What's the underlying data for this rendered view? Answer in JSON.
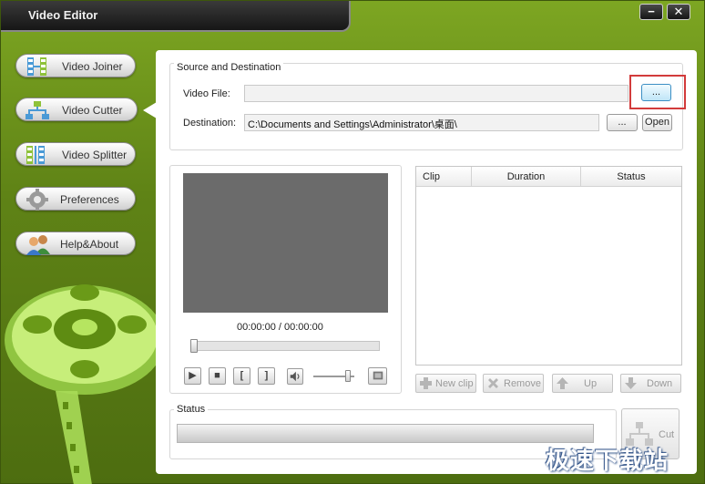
{
  "window": {
    "title": "Video Editor",
    "minimize_label": "−",
    "close_label": "✕"
  },
  "sidebar": {
    "items": [
      {
        "label": "Video Joiner",
        "icon": "video-joiner-icon"
      },
      {
        "label": "Video Cutter",
        "icon": "video-cutter-icon",
        "active": true
      },
      {
        "label": "Video Splitter",
        "icon": "video-splitter-icon"
      },
      {
        "label": "Preferences",
        "icon": "gear-icon"
      },
      {
        "label": "Help&About",
        "icon": "users-icon"
      }
    ]
  },
  "source": {
    "group_title": "Source and Destination",
    "video_file_label": "Video File:",
    "video_file_value": "",
    "browse_label": "...",
    "destination_label": "Destination:",
    "destination_value": "C:\\Documents and Settings\\Administrator\\桌面\\",
    "dest_browse_label": "...",
    "open_label": "Open"
  },
  "player": {
    "time": "00:00:00 / 00:00:00",
    "progress": 0,
    "volume": 0.9,
    "play_icon": "▶",
    "stop_icon": "■",
    "mark_in_icon": "[",
    "mark_out_icon": "]"
  },
  "clips": {
    "columns": [
      "Clip",
      "Duration",
      "Status"
    ],
    "rows": [],
    "new_clip_label": "New clip",
    "remove_label": "Remove",
    "up_label": "Up",
    "down_label": "Down"
  },
  "status": {
    "group_title": "Status",
    "progress": 0,
    "cut_label": "Cut"
  },
  "watermark": "极速下载站",
  "colors": {
    "accent_green": "#6a8f1a",
    "highlight_red": "#d23b3b",
    "focus_blue": "#3c8fc4"
  }
}
